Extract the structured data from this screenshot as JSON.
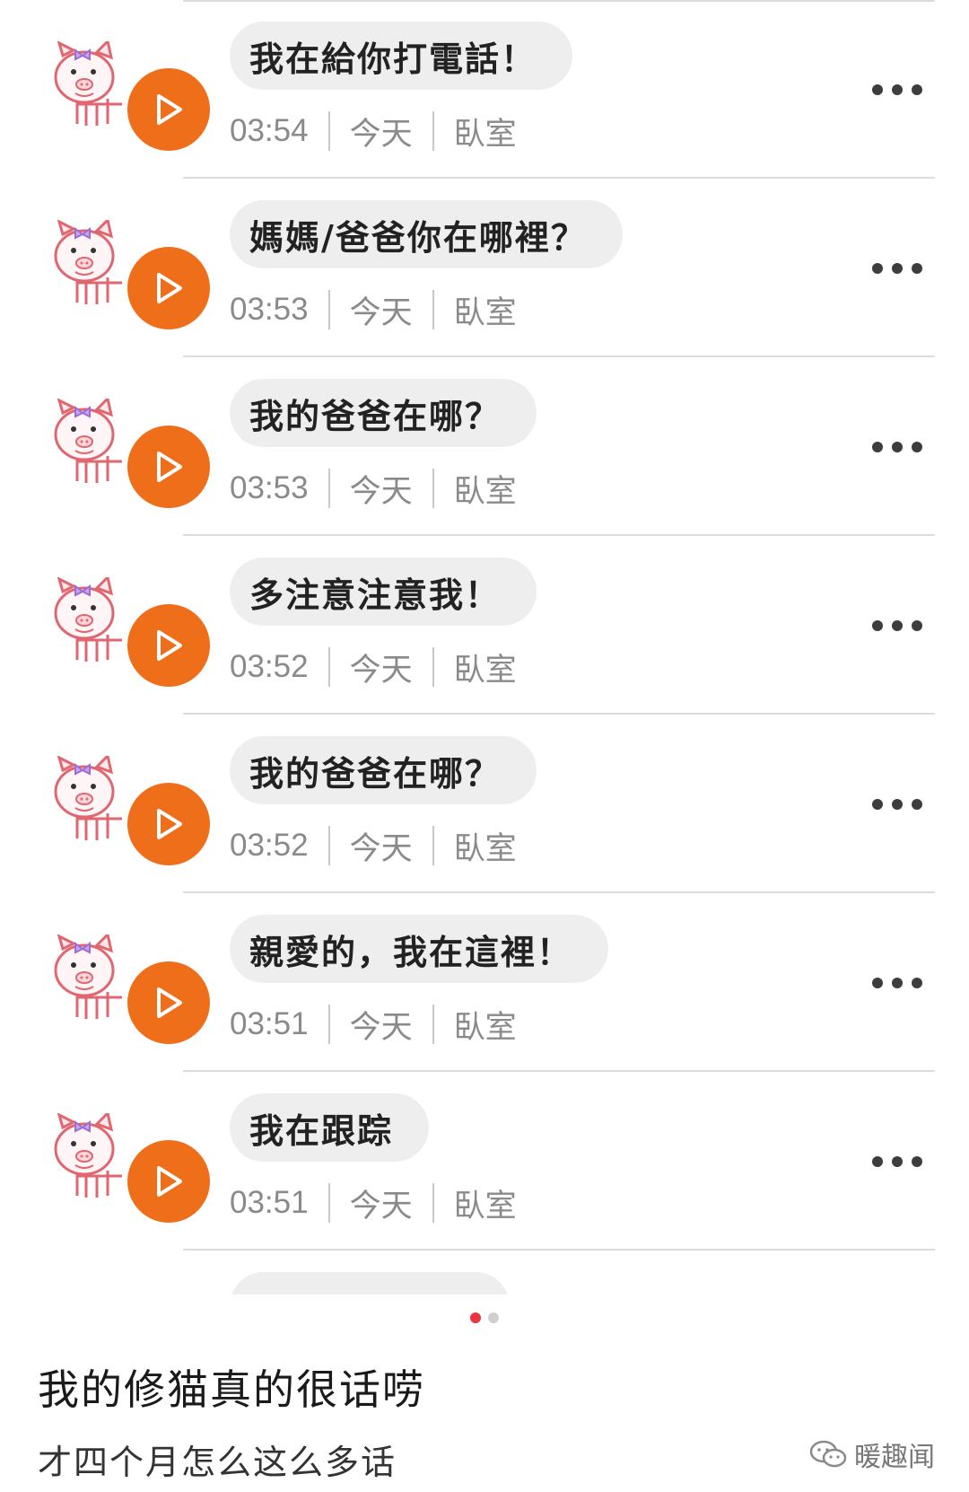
{
  "messages": [
    {
      "text": "我在給你打電話！",
      "time": "03:54",
      "day": "今天",
      "room": "臥室"
    },
    {
      "text": "媽媽/爸爸你在哪裡？",
      "time": "03:53",
      "day": "今天",
      "room": "臥室"
    },
    {
      "text": "我的爸爸在哪？",
      "time": "03:53",
      "day": "今天",
      "room": "臥室"
    },
    {
      "text": "多注意注意我！",
      "time": "03:52",
      "day": "今天",
      "room": "臥室"
    },
    {
      "text": "我的爸爸在哪？",
      "time": "03:52",
      "day": "今天",
      "room": "臥室"
    },
    {
      "text": "親愛的，我在這裡！",
      "time": "03:51",
      "day": "今天",
      "room": "臥室"
    },
    {
      "text": "我在跟踪",
      "time": "03:51",
      "day": "今天",
      "room": "臥室"
    }
  ],
  "pagination": {
    "total": 2,
    "active": 1
  },
  "post": {
    "caption": "我的修猫真的很话唠",
    "subcaption": "才四个月怎么这么多话"
  },
  "watermark": {
    "text": "暖趣闻",
    "icon": "wechat-icon"
  },
  "colors": {
    "play": "#ee6e1a",
    "active_dot": "#e8353f"
  }
}
